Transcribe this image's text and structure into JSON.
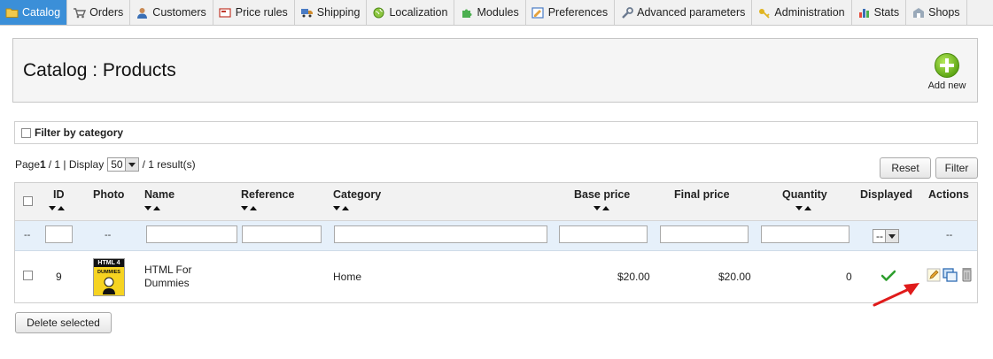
{
  "nav": {
    "tabs": [
      {
        "label": "Catalog",
        "icon": "folder-icon",
        "active": true
      },
      {
        "label": "Orders",
        "icon": "cart-icon"
      },
      {
        "label": "Customers",
        "icon": "user-icon"
      },
      {
        "label": "Price rules",
        "icon": "price-tag-icon"
      },
      {
        "label": "Shipping",
        "icon": "truck-icon"
      },
      {
        "label": "Localization",
        "icon": "globe-icon"
      },
      {
        "label": "Modules",
        "icon": "puzzle-icon"
      },
      {
        "label": "Preferences",
        "icon": "preferences-icon"
      },
      {
        "label": "Advanced parameters",
        "icon": "wrench-icon"
      },
      {
        "label": "Administration",
        "icon": "key-icon"
      },
      {
        "label": "Stats",
        "icon": "bar-chart-icon"
      },
      {
        "label": "Shops",
        "icon": "shop-icon"
      }
    ]
  },
  "header": {
    "title": "Catalog : Products",
    "add_new_label": "Add new"
  },
  "filter": {
    "by_category_label": "Filter by category"
  },
  "pagination": {
    "page_label": "Page",
    "current_page": "1",
    "total_pages": "/ 1 | Display",
    "per_page": "50",
    "results": "/ 1 result(s)"
  },
  "actions": {
    "reset_label": "Reset",
    "filter_label": "Filter",
    "delete_selected_label": "Delete selected"
  },
  "table": {
    "columns": {
      "id": "ID",
      "photo": "Photo",
      "name": "Name",
      "reference": "Reference",
      "category": "Category",
      "base_price": "Base price",
      "final_price": "Final price",
      "quantity": "Quantity",
      "displayed": "Displayed",
      "actions": "Actions"
    },
    "filter_row": {
      "dash": "--",
      "displayed_value": "--"
    },
    "rows": [
      {
        "id": "9",
        "name_line1": "HTML For",
        "name_line2": "Dummies",
        "reference": "",
        "category": "Home",
        "base_price": "$20.00",
        "final_price": "$20.00",
        "quantity": "0",
        "displayed": true,
        "thumb_text_1": "HTML 4",
        "thumb_text_2": "DUMMIES"
      }
    ]
  },
  "colors": {
    "active_tab": "#3b8fd8",
    "filter_row": "#e6f0fa",
    "checkmark": "#2e9e2e",
    "annotation_arrow": "#e01b1b",
    "add_button": "#7cc41c"
  }
}
